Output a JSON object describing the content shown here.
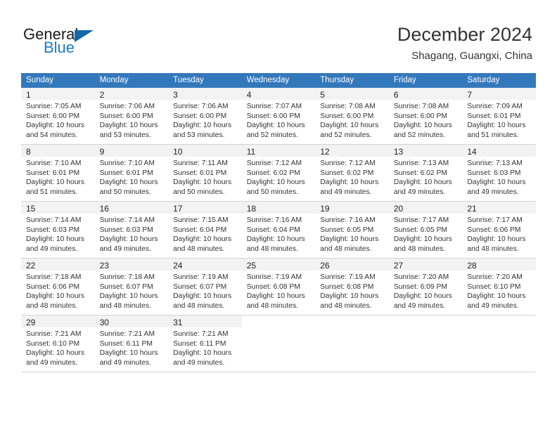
{
  "brand": {
    "name_part1": "General",
    "name_part2": "Blue",
    "triangle_icon": "triangle-logo-icon",
    "color_primary": "#1267ad",
    "color_secondary": "#1a7bc4"
  },
  "header": {
    "month_title": "December 2024",
    "location": "Shagang, Guangxi, China",
    "accent_color": "#3478bc"
  },
  "calendar": {
    "weekday_headers": [
      "Sunday",
      "Monday",
      "Tuesday",
      "Wednesday",
      "Thursday",
      "Friday",
      "Saturday"
    ],
    "weeks": [
      [
        {
          "day": "1",
          "lines": [
            "Sunrise: 7:05 AM",
            "Sunset: 6:00 PM",
            "Daylight: 10 hours",
            "and 54 minutes."
          ]
        },
        {
          "day": "2",
          "lines": [
            "Sunrise: 7:06 AM",
            "Sunset: 6:00 PM",
            "Daylight: 10 hours",
            "and 53 minutes."
          ]
        },
        {
          "day": "3",
          "lines": [
            "Sunrise: 7:06 AM",
            "Sunset: 6:00 PM",
            "Daylight: 10 hours",
            "and 53 minutes."
          ]
        },
        {
          "day": "4",
          "lines": [
            "Sunrise: 7:07 AM",
            "Sunset: 6:00 PM",
            "Daylight: 10 hours",
            "and 52 minutes."
          ]
        },
        {
          "day": "5",
          "lines": [
            "Sunrise: 7:08 AM",
            "Sunset: 6:00 PM",
            "Daylight: 10 hours",
            "and 52 minutes."
          ]
        },
        {
          "day": "6",
          "lines": [
            "Sunrise: 7:08 AM",
            "Sunset: 6:00 PM",
            "Daylight: 10 hours",
            "and 52 minutes."
          ]
        },
        {
          "day": "7",
          "lines": [
            "Sunrise: 7:09 AM",
            "Sunset: 6:01 PM",
            "Daylight: 10 hours",
            "and 51 minutes."
          ]
        }
      ],
      [
        {
          "day": "8",
          "lines": [
            "Sunrise: 7:10 AM",
            "Sunset: 6:01 PM",
            "Daylight: 10 hours",
            "and 51 minutes."
          ]
        },
        {
          "day": "9",
          "lines": [
            "Sunrise: 7:10 AM",
            "Sunset: 6:01 PM",
            "Daylight: 10 hours",
            "and 50 minutes."
          ]
        },
        {
          "day": "10",
          "lines": [
            "Sunrise: 7:11 AM",
            "Sunset: 6:01 PM",
            "Daylight: 10 hours",
            "and 50 minutes."
          ]
        },
        {
          "day": "11",
          "lines": [
            "Sunrise: 7:12 AM",
            "Sunset: 6:02 PM",
            "Daylight: 10 hours",
            "and 50 minutes."
          ]
        },
        {
          "day": "12",
          "lines": [
            "Sunrise: 7:12 AM",
            "Sunset: 6:02 PM",
            "Daylight: 10 hours",
            "and 49 minutes."
          ]
        },
        {
          "day": "13",
          "lines": [
            "Sunrise: 7:13 AM",
            "Sunset: 6:02 PM",
            "Daylight: 10 hours",
            "and 49 minutes."
          ]
        },
        {
          "day": "14",
          "lines": [
            "Sunrise: 7:13 AM",
            "Sunset: 6:03 PM",
            "Daylight: 10 hours",
            "and 49 minutes."
          ]
        }
      ],
      [
        {
          "day": "15",
          "lines": [
            "Sunrise: 7:14 AM",
            "Sunset: 6:03 PM",
            "Daylight: 10 hours",
            "and 49 minutes."
          ]
        },
        {
          "day": "16",
          "lines": [
            "Sunrise: 7:14 AM",
            "Sunset: 6:03 PM",
            "Daylight: 10 hours",
            "and 49 minutes."
          ]
        },
        {
          "day": "17",
          "lines": [
            "Sunrise: 7:15 AM",
            "Sunset: 6:04 PM",
            "Daylight: 10 hours",
            "and 48 minutes."
          ]
        },
        {
          "day": "18",
          "lines": [
            "Sunrise: 7:16 AM",
            "Sunset: 6:04 PM",
            "Daylight: 10 hours",
            "and 48 minutes."
          ]
        },
        {
          "day": "19",
          "lines": [
            "Sunrise: 7:16 AM",
            "Sunset: 6:05 PM",
            "Daylight: 10 hours",
            "and 48 minutes."
          ]
        },
        {
          "day": "20",
          "lines": [
            "Sunrise: 7:17 AM",
            "Sunset: 6:05 PM",
            "Daylight: 10 hours",
            "and 48 minutes."
          ]
        },
        {
          "day": "21",
          "lines": [
            "Sunrise: 7:17 AM",
            "Sunset: 6:06 PM",
            "Daylight: 10 hours",
            "and 48 minutes."
          ]
        }
      ],
      [
        {
          "day": "22",
          "lines": [
            "Sunrise: 7:18 AM",
            "Sunset: 6:06 PM",
            "Daylight: 10 hours",
            "and 48 minutes."
          ]
        },
        {
          "day": "23",
          "lines": [
            "Sunrise: 7:18 AM",
            "Sunset: 6:07 PM",
            "Daylight: 10 hours",
            "and 48 minutes."
          ]
        },
        {
          "day": "24",
          "lines": [
            "Sunrise: 7:19 AM",
            "Sunset: 6:07 PM",
            "Daylight: 10 hours",
            "and 48 minutes."
          ]
        },
        {
          "day": "25",
          "lines": [
            "Sunrise: 7:19 AM",
            "Sunset: 6:08 PM",
            "Daylight: 10 hours",
            "and 48 minutes."
          ]
        },
        {
          "day": "26",
          "lines": [
            "Sunrise: 7:19 AM",
            "Sunset: 6:08 PM",
            "Daylight: 10 hours",
            "and 48 minutes."
          ]
        },
        {
          "day": "27",
          "lines": [
            "Sunrise: 7:20 AM",
            "Sunset: 6:09 PM",
            "Daylight: 10 hours",
            "and 49 minutes."
          ]
        },
        {
          "day": "28",
          "lines": [
            "Sunrise: 7:20 AM",
            "Sunset: 6:10 PM",
            "Daylight: 10 hours",
            "and 49 minutes."
          ]
        }
      ],
      [
        {
          "day": "29",
          "lines": [
            "Sunrise: 7:21 AM",
            "Sunset: 6:10 PM",
            "Daylight: 10 hours",
            "and 49 minutes."
          ]
        },
        {
          "day": "30",
          "lines": [
            "Sunrise: 7:21 AM",
            "Sunset: 6:11 PM",
            "Daylight: 10 hours",
            "and 49 minutes."
          ]
        },
        {
          "day": "31",
          "lines": [
            "Sunrise: 7:21 AM",
            "Sunset: 6:11 PM",
            "Daylight: 10 hours",
            "and 49 minutes."
          ]
        },
        {
          "day": "",
          "lines": []
        },
        {
          "day": "",
          "lines": []
        },
        {
          "day": "",
          "lines": []
        },
        {
          "day": "",
          "lines": []
        }
      ]
    ]
  }
}
